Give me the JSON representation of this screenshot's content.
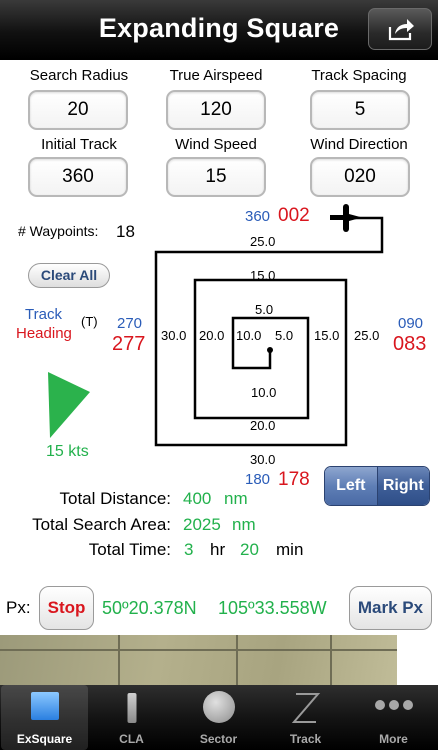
{
  "header": {
    "title": "Expanding Square"
  },
  "fields": [
    {
      "label": "Search Radius",
      "value": "20"
    },
    {
      "label": "True Airspeed",
      "value": "120"
    },
    {
      "label": "Track Spacing",
      "value": "5"
    },
    {
      "label": "Initial Track",
      "value": "360"
    },
    {
      "label": "Wind Speed",
      "value": "15"
    },
    {
      "label": "Wind Direction",
      "value": "020"
    }
  ],
  "waypoints": {
    "label": "# Waypoints:",
    "value": "18"
  },
  "clear_all": "Clear All",
  "legend": {
    "track": "Track",
    "heading": "Heading",
    "true_marker": "(T)"
  },
  "compass": {
    "north": {
      "track": "360",
      "heading": "002"
    },
    "south": {
      "track": "180",
      "heading": "178"
    },
    "west": {
      "track": "270",
      "heading": "277"
    },
    "east": {
      "track": "090",
      "heading": "083"
    }
  },
  "legs": {
    "top": [
      "25.0",
      "15.0",
      "5.0"
    ],
    "bottom": [
      "10.0",
      "20.0",
      "30.0"
    ],
    "left": [
      "30.0",
      "20.0",
      "10.0"
    ],
    "right": [
      "5.0",
      "15.0",
      "25.0"
    ]
  },
  "wind": {
    "label": "15 kts"
  },
  "turn_direction": {
    "options": [
      "Left",
      "Right"
    ],
    "selected": "Right"
  },
  "totals": {
    "distance": {
      "label": "Total Distance:",
      "value": "400",
      "unit": "nm"
    },
    "area": {
      "label": "Total Search Area:",
      "value": "2025",
      "unit": "nm"
    },
    "time": {
      "label": "Total Time:",
      "hours": "3",
      "hr_unit": "hr",
      "minutes": "20",
      "min_unit": "min"
    }
  },
  "px": {
    "label": "Px:",
    "stop": "Stop",
    "lat": "50º20.378N",
    "lon": "105º33.558W",
    "mark": "Mark Px"
  },
  "tabs": [
    {
      "label": "ExSquare",
      "icon": "square-icon",
      "active": true
    },
    {
      "label": "CLA",
      "icon": "bar-icon",
      "active": false
    },
    {
      "label": "Sector",
      "icon": "circle-icon",
      "active": false
    },
    {
      "label": "Track",
      "icon": "zigzag-icon",
      "active": false
    },
    {
      "label": "More",
      "icon": "dots-icon",
      "active": false
    }
  ],
  "colors": {
    "track": "#2a5cb8",
    "heading": "#d9161e",
    "value_green": "#22b14c",
    "wind": "#22b14c"
  }
}
